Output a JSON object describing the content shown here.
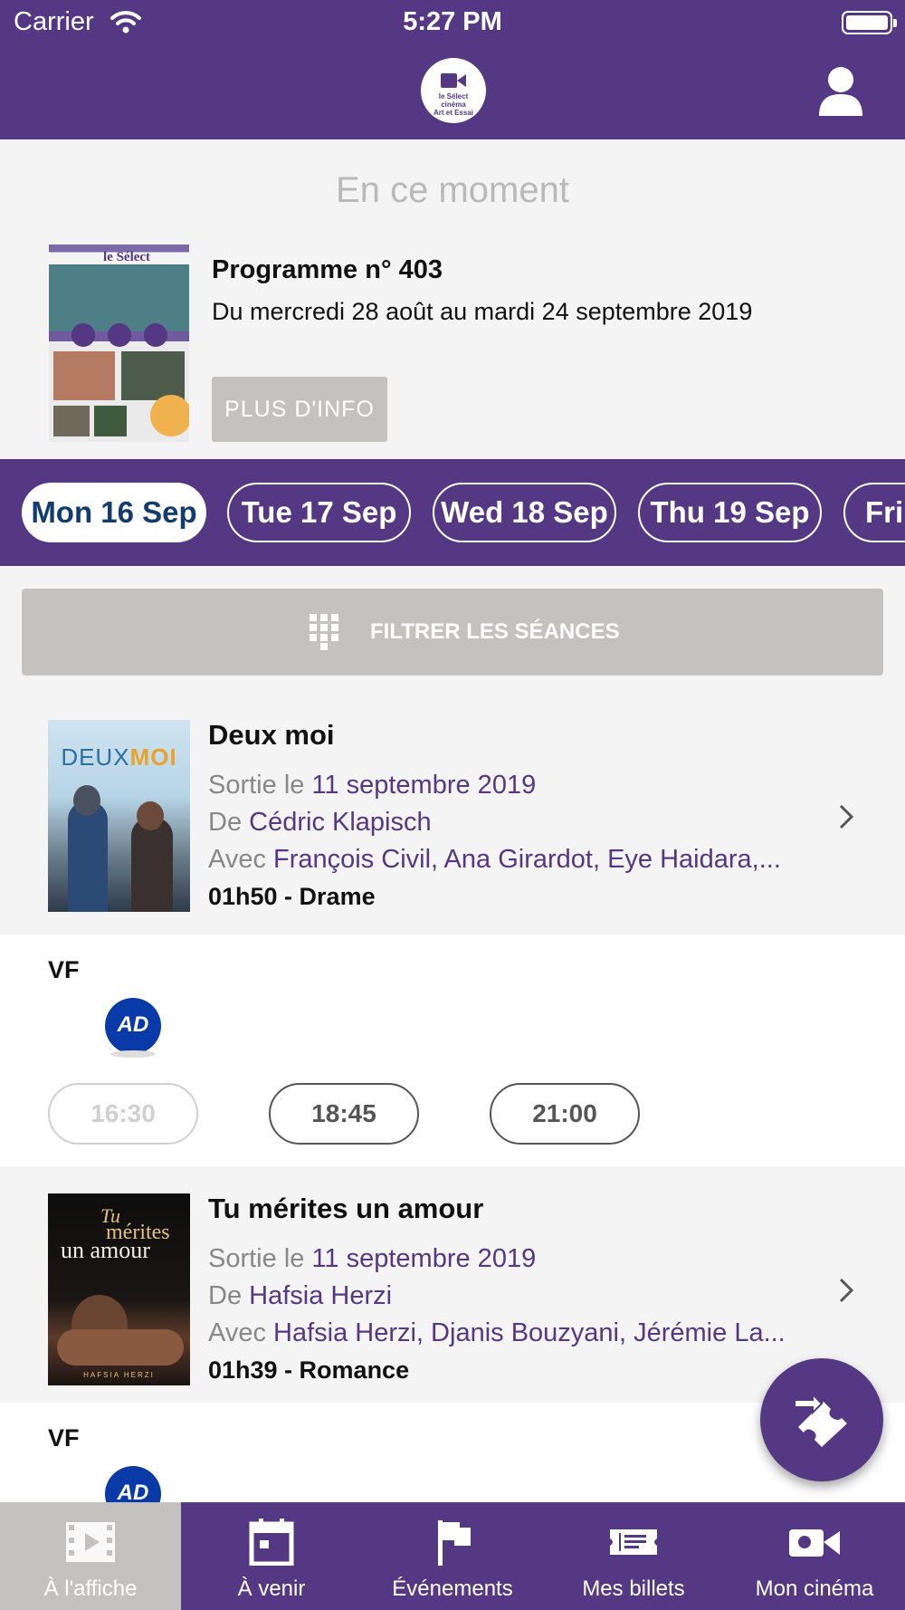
{
  "status_bar": {
    "carrier": "Carrier",
    "time": "5:27 PM"
  },
  "app": {
    "logo_text_1": "le Sélect",
    "logo_text_2": "cinéma",
    "logo_text_3": "Art et Essai"
  },
  "hero": {
    "heading": "En ce moment",
    "program_poster_title": "le Sélect",
    "program_title": "Programme n° 403",
    "program_dates": "Du mercredi 28 août au mardi 24 septembre 2019",
    "info_button": "PLUS D'INFO"
  },
  "dates": [
    {
      "label": "Mon 16 Sep",
      "selected": true
    },
    {
      "label": "Tue 17 Sep",
      "selected": false
    },
    {
      "label": "Wed 18 Sep",
      "selected": false
    },
    {
      "label": "Thu 19 Sep",
      "selected": false
    },
    {
      "label": "Fri",
      "selected": false
    }
  ],
  "filter": {
    "label": "FILTRER LES SÉANCES"
  },
  "movies": [
    {
      "title": "Deux moi",
      "release_prefix": "Sortie le",
      "release_date": "11 septembre 2019",
      "director_prefix": "De",
      "director": "Cédric Klapisch",
      "cast_prefix": "Avec",
      "cast": "François Civil, Ana Girardot, Eye Haidara,...",
      "meta": "01h50 - Drame",
      "poster_text_1": "DEUX",
      "poster_text_2": "MOI",
      "language": "VF",
      "accessibility": "AD",
      "showtimes": [
        {
          "time": "16:30",
          "available": false
        },
        {
          "time": "18:45",
          "available": true
        },
        {
          "time": "21:00",
          "available": true
        }
      ]
    },
    {
      "title": "Tu mérites un amour",
      "release_prefix": "Sortie le",
      "release_date": "11 septembre 2019",
      "director_prefix": "De",
      "director": "Hafsia Herzi",
      "cast_prefix": "Avec",
      "cast": "Hafsia Herzi, Djanis Bouzyani, Jérémie La...",
      "meta": "01h39 - Romance",
      "poster_text_1": "Tu",
      "poster_text_2": "mérites",
      "poster_text_3": "un amour",
      "poster_text_4": "HAFSIA HERZI",
      "language": "VF",
      "accessibility": "AD"
    }
  ],
  "tabs": [
    {
      "label": "À l'affiche",
      "icon": "film-icon",
      "active": true
    },
    {
      "label": "À venir",
      "icon": "calendar-icon",
      "active": false
    },
    {
      "label": "Événements",
      "icon": "flag-icon",
      "active": false
    },
    {
      "label": "Mes billets",
      "icon": "ticket-icon",
      "active": false
    },
    {
      "label": "Mon cinéma",
      "icon": "camera-icon",
      "active": false
    }
  ],
  "colors": {
    "brand": "#543884",
    "button_gray": "#c4c1c1",
    "selected_date_text": "#123c6e",
    "ad_blue": "#0a3aa8"
  }
}
